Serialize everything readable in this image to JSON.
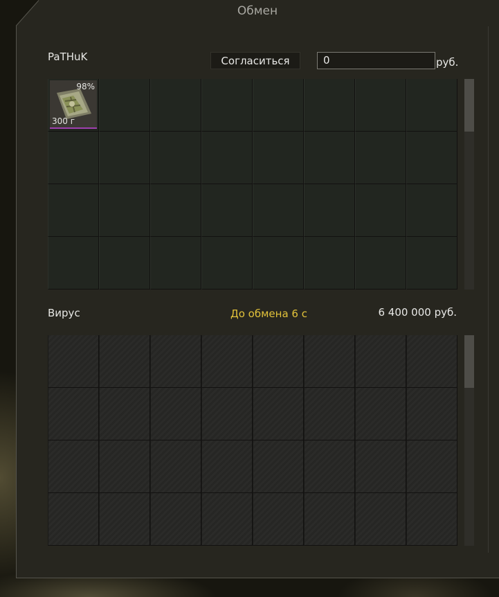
{
  "window": {
    "title": "Обмен"
  },
  "my_side": {
    "player_name": "PaTHuK",
    "accept_label": "Согласиться",
    "money_value": "0",
    "currency": "руб.",
    "item": {
      "icon": "map-icon",
      "condition": "98%",
      "weight": "300 г",
      "rarity_color": "#a040b0"
    }
  },
  "their_side": {
    "player_name": "Вирус",
    "timer_text": "До обмена 6 с",
    "total_text": "6 400 000 руб."
  },
  "colors": {
    "timer": "#e2c23a",
    "panel": "#27261f"
  }
}
